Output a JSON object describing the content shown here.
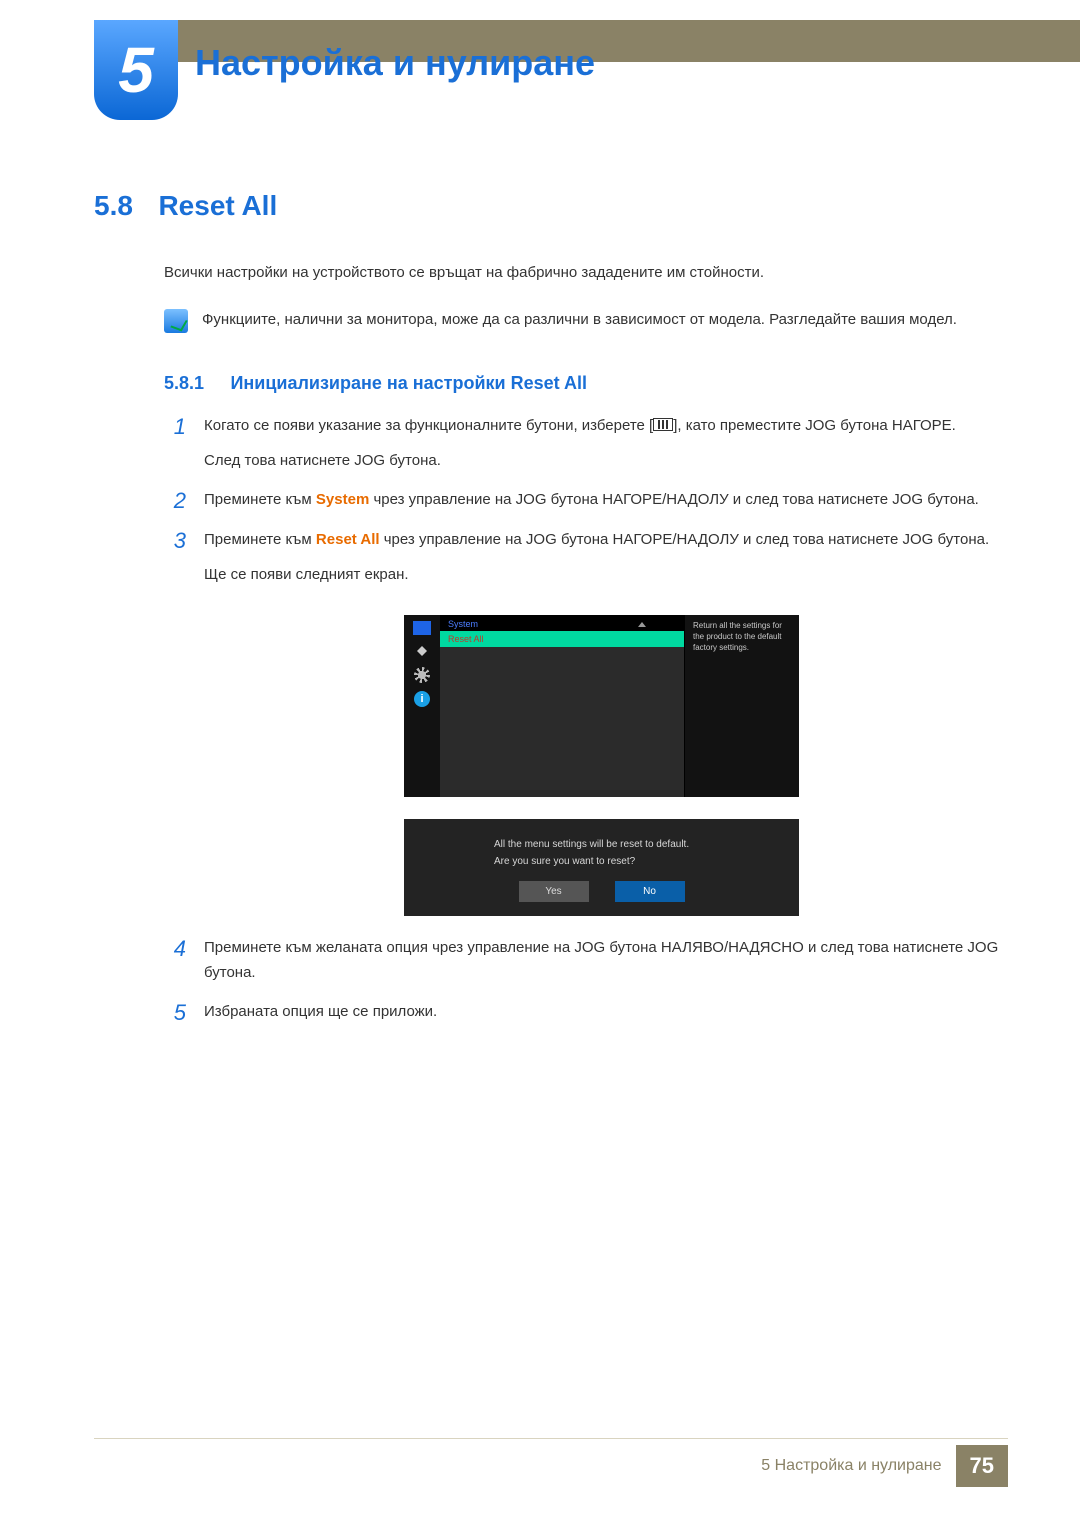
{
  "chapter": {
    "number": "5",
    "title": "Настройка и нулиране"
  },
  "section": {
    "number": "5.8",
    "title": "Reset All"
  },
  "intro": "Всички настройки на устройството се връщат на фабрично зададените им стойности.",
  "note": "Функциите, налични за монитора, може да са различни в зависимост от модела. Разгледайте вашия модел.",
  "subsection": {
    "number": "5.8.1",
    "title": "Инициализиране на настройки Reset All"
  },
  "steps": {
    "s1": {
      "num": "1",
      "pre": "Когато се появи указание за функционалните бутони, изберете [",
      "post": "], като преместите JOG бутона НАГОРЕ.",
      "line2": "След това натиснете JOG бутона."
    },
    "s2": {
      "num": "2",
      "t_a": "Преминете към ",
      "hl": "System",
      "t_b": " чрез управление на JOG бутона НАГОРЕ/НАДОЛУ и след това натиснете JOG бутона."
    },
    "s3": {
      "num": "3",
      "t_a": "Преминете към ",
      "hl": "Reset All",
      "t_b": " чрез управление на JOG бутона НАГОРЕ/НАДОЛУ и след това натиснете JOG бутона.",
      "line2": "Ще се появи следният екран."
    },
    "s4": {
      "num": "4",
      "text": "Преминете към желаната опция чрез управление на JOG бутона НАЛЯВО/НАДЯСНО и след това натиснете JOG бутона."
    },
    "s5": {
      "num": "5",
      "text": "Избраната опция ще се приложи."
    }
  },
  "osd": {
    "menu_title": "System",
    "selected_item": "Reset All",
    "help_text": "Return all the settings for the product to the default factory settings.",
    "info_glyph": "i",
    "confirm_line1": "All the menu settings will be reset to default.",
    "confirm_line2": "Are you sure you want to reset?",
    "btn_yes": "Yes",
    "btn_no": "No"
  },
  "footer": {
    "text": "5 Настройка и нулиране",
    "page": "75"
  }
}
